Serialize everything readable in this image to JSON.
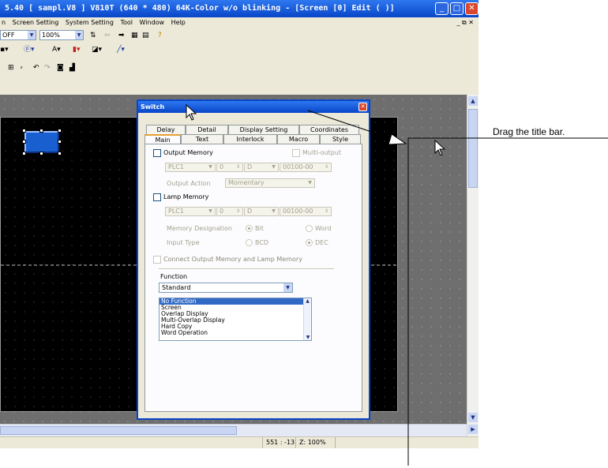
{
  "window": {
    "title": "5.40 [ sampl.V8 ] V810T (640 * 480) 64K-Color w/o blinking - [Screen [0] Edit (                    )]",
    "min": "_",
    "max": "□",
    "close": "✕"
  },
  "menubar": {
    "items": [
      "n",
      "Screen Setting",
      "System Setting",
      "Tool",
      "Window",
      "Help"
    ],
    "mdi_controls": "_ ⧉ ✕"
  },
  "toolbar1": {
    "combo1": "OFF",
    "combo2": "100%"
  },
  "statusbar": {
    "coords": "551 : -13",
    "zoom": "Z: 100%"
  },
  "dialog": {
    "title": "Switch",
    "tabs_back": [
      "Delay",
      "Detail",
      "Display Setting",
      "Coordinates"
    ],
    "tabs_front": [
      "Main",
      "Text",
      "Interlock",
      "Macro",
      "Style"
    ],
    "active_tab": "Main",
    "main": {
      "output_memory": "Output Memory",
      "multi_output": "Multi-output",
      "out_plc": "PLC1",
      "out_station": "0",
      "out_device": "D",
      "out_address": "00100-00",
      "output_action_label": "Output Action",
      "output_action_value": "Momentary",
      "lamp_memory": "Lamp Memory",
      "lamp_plc": "PLC1",
      "lamp_station": "0",
      "lamp_device": "D",
      "lamp_address": "00100-00",
      "memory_designation_label": "Memory Designation",
      "bit": "Bit",
      "word": "Word",
      "input_type_label": "Input Type",
      "bcd": "BCD",
      "dec": "DEC",
      "connect_label": "Connect Output Memory and Lamp Memory",
      "function_label": "Function",
      "function_value": "Standard",
      "function_list": [
        "No Function",
        "Screen",
        "Overlap Display",
        "Multi-Overlap Display",
        "Hard Copy",
        "Word Operation"
      ]
    }
  },
  "annotation": {
    "text": "Drag the title bar."
  }
}
